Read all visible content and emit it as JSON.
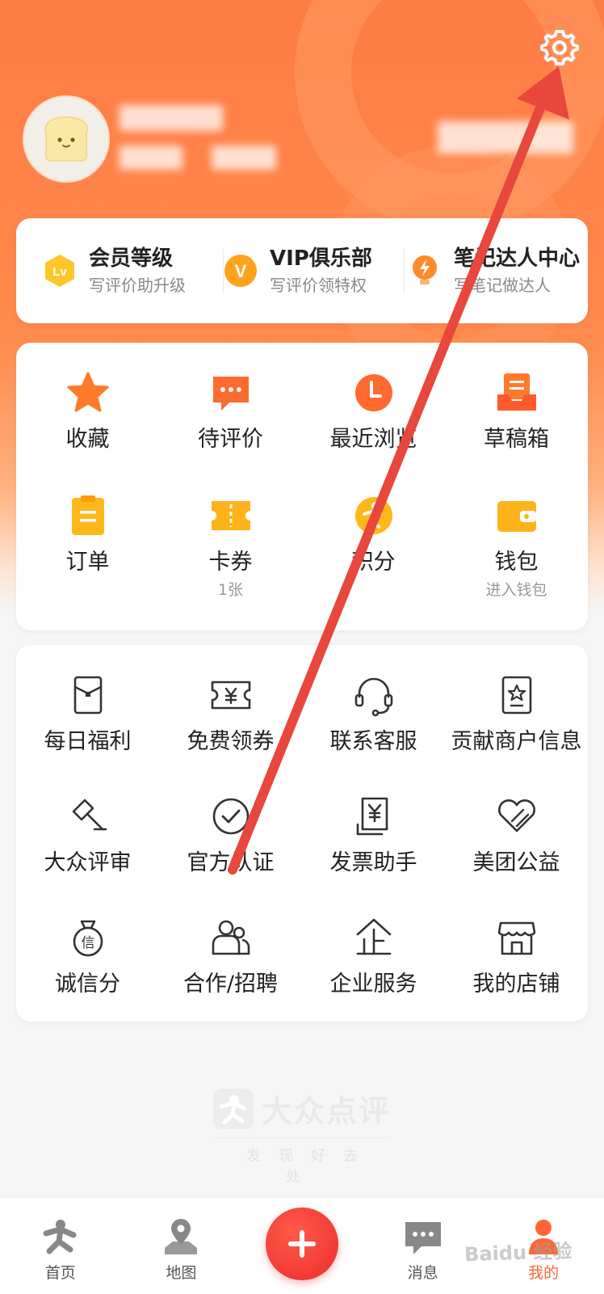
{
  "membership": [
    {
      "title": "会员等级",
      "subtitle": "写评价助升级",
      "icon": "level-badge-icon"
    },
    {
      "title": "VIP俱乐部",
      "subtitle": "写评价领特权",
      "icon": "vip-badge-icon"
    },
    {
      "title": "笔记达人中心",
      "subtitle": "写笔记做达人",
      "icon": "bolt-bulb-icon"
    }
  ],
  "tools": [
    {
      "label": "收藏",
      "sub": "",
      "icon": "star-icon"
    },
    {
      "label": "待评价",
      "sub": "",
      "icon": "comment-icon"
    },
    {
      "label": "最近浏览",
      "sub": "",
      "icon": "clock-icon"
    },
    {
      "label": "草稿箱",
      "sub": "",
      "icon": "drafts-tray-icon"
    },
    {
      "label": "订单",
      "sub": "",
      "icon": "clipboard-icon"
    },
    {
      "label": "卡券",
      "sub": "1张",
      "icon": "ticket-icon"
    },
    {
      "label": "积分",
      "sub": "",
      "icon": "points-icon"
    },
    {
      "label": "钱包",
      "sub": "进入钱包",
      "icon": "wallet-icon"
    }
  ],
  "services": [
    {
      "label": "每日福利",
      "icon": "red-envelope-icon"
    },
    {
      "label": "免费领券",
      "icon": "yen-ticket-icon"
    },
    {
      "label": "联系客服",
      "icon": "headset-icon"
    },
    {
      "label": "贡献商户信息",
      "icon": "star-card-icon"
    },
    {
      "label": "大众评审",
      "icon": "gavel-icon"
    },
    {
      "label": "官方认证",
      "icon": "check-circle-icon"
    },
    {
      "label": "发票助手",
      "icon": "invoice-icon"
    },
    {
      "label": "美团公益",
      "icon": "charity-heart-icon"
    },
    {
      "label": "诚信分",
      "icon": "credit-bag-icon"
    },
    {
      "label": "合作/招聘",
      "icon": "people-icon"
    },
    {
      "label": "企业服务",
      "icon": "enterprise-icon"
    },
    {
      "label": "我的店铺",
      "icon": "storefront-icon"
    }
  ],
  "brand": {
    "name": "大众点评",
    "slogan": "发现好去处"
  },
  "tabs": [
    {
      "label": "首页",
      "icon": "home-person-icon"
    },
    {
      "label": "地图",
      "icon": "map-pin-icon"
    },
    {
      "label": "",
      "icon": "plus-icon"
    },
    {
      "label": "消息",
      "icon": "message-icon"
    },
    {
      "label": "我的",
      "icon": "me-icon"
    }
  ],
  "watermark": "Baidu 经验",
  "colors": {
    "primary": "#ff6633",
    "header": "#ff7c44",
    "plus_button": "#f03c32",
    "annotation_arrow": "#e8473c"
  }
}
